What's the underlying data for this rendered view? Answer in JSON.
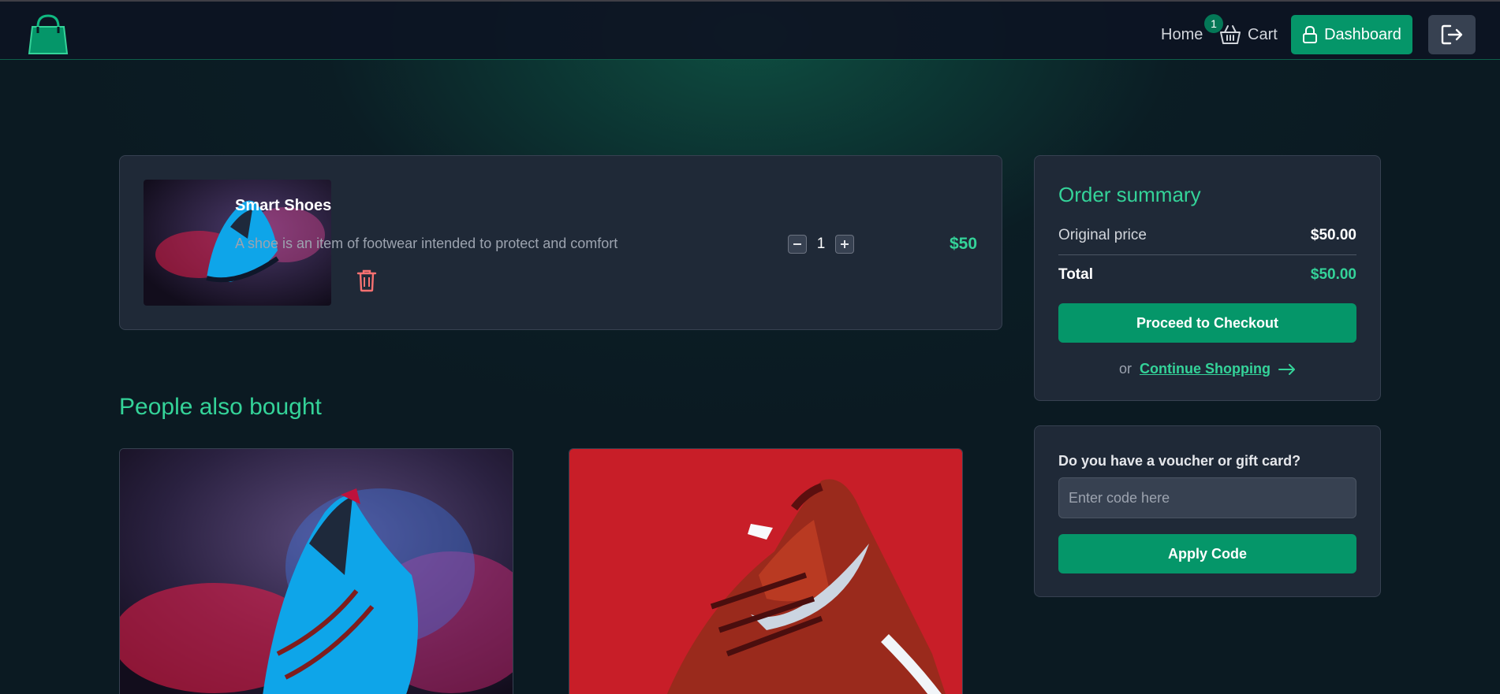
{
  "nav": {
    "home_label": "Home",
    "cart_label": "Cart",
    "cart_count": "1",
    "dashboard_label": "Dashboard"
  },
  "cart_item": {
    "name": "Smart Shoes",
    "description": "A shoe is an item of footwear intended to protect and comfort",
    "quantity": "1",
    "price": "$50"
  },
  "recommendations": {
    "title": "People also bought"
  },
  "order_summary": {
    "title": "Order summary",
    "original_price_label": "Original price",
    "original_price_value": "$50.00",
    "total_label": "Total",
    "total_value": "$50.00",
    "checkout_label": "Proceed to Checkout",
    "or_text": "or",
    "continue_label": "Continue Shopping"
  },
  "voucher": {
    "label": "Do you have a voucher or gift card?",
    "placeholder": "Enter code here",
    "value": "",
    "apply_label": "Apply Code"
  },
  "colors": {
    "accent": "#10b981",
    "button": "#059669",
    "card": "#1f2937",
    "background": "#0b1a22"
  }
}
